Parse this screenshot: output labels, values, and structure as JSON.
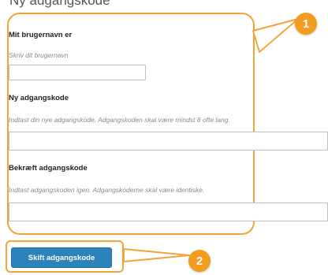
{
  "page": {
    "title": "Ny adgangskode"
  },
  "form": {
    "username": {
      "label": "Mit brugernavn er",
      "placeholder": "Skriv dit brugernavn",
      "value": ""
    },
    "new_password": {
      "label": "Ny adgangskode",
      "hint": "Indtast din nye adgangskode. Adgangskoden skal være mindst 8 ofte lang.",
      "value": ""
    },
    "confirm_password": {
      "label": "Bekræft adgangskode",
      "hint": "Indtast adgangskoden igen. Adgangskoderne skal være identiske.",
      "value": ""
    }
  },
  "submit": {
    "label": "Skift adgangskode"
  },
  "callouts": [
    {
      "number": "1"
    },
    {
      "number": "2"
    }
  ],
  "colors": {
    "accent": "#f3a43a",
    "badge": "#f39c1f",
    "button": "#2b83b9"
  }
}
